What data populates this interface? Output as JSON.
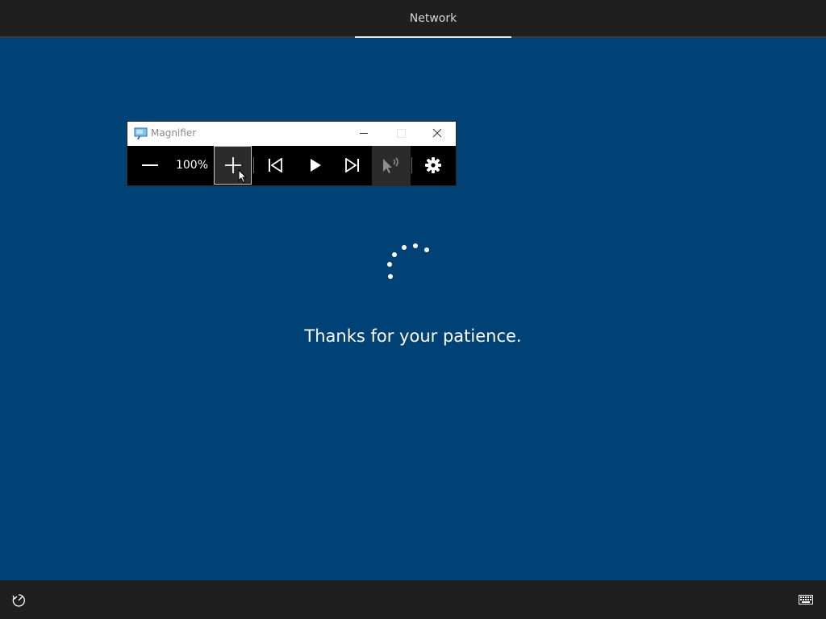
{
  "header": {
    "tabs": [
      {
        "label": "Network",
        "active": true
      }
    ]
  },
  "magnifier": {
    "title": "Magnifier",
    "zoom_level": "100%",
    "toolbar_icons": [
      "minus-icon",
      "plus-icon",
      "skip-back-icon",
      "play-icon",
      "skip-forward-icon",
      "read-from-mouse-icon",
      "gear-icon"
    ]
  },
  "main": {
    "message": "Thanks for your patience."
  },
  "footer": {
    "icons": [
      "ease-of-access-icon",
      "keyboard-icon"
    ]
  },
  "colors": {
    "background": "#004275",
    "bars": "#1f1f1f",
    "magnifier_toolbar": "#000000"
  }
}
